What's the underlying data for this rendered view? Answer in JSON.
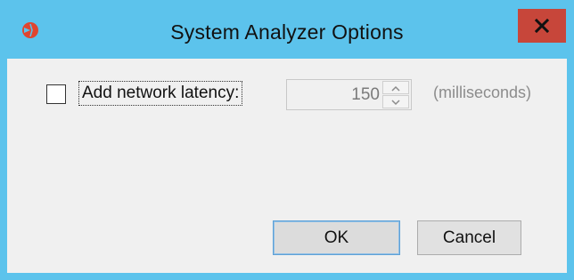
{
  "window": {
    "title": "System Analyzer Options",
    "close_label": "X",
    "frame_color": "#5cc3ec",
    "close_color": "#c7463a"
  },
  "options": {
    "latency_checkbox_checked": false,
    "latency_label": "Add network latency:",
    "latency_value": "150",
    "latency_unit": "(milliseconds)"
  },
  "buttons": {
    "ok_label": "OK",
    "cancel_label": "Cancel"
  },
  "icons": {
    "app": "analyzer-app-icon",
    "close": "close-icon",
    "spin_up": "chevron-up-icon",
    "spin_down": "chevron-down-icon"
  }
}
